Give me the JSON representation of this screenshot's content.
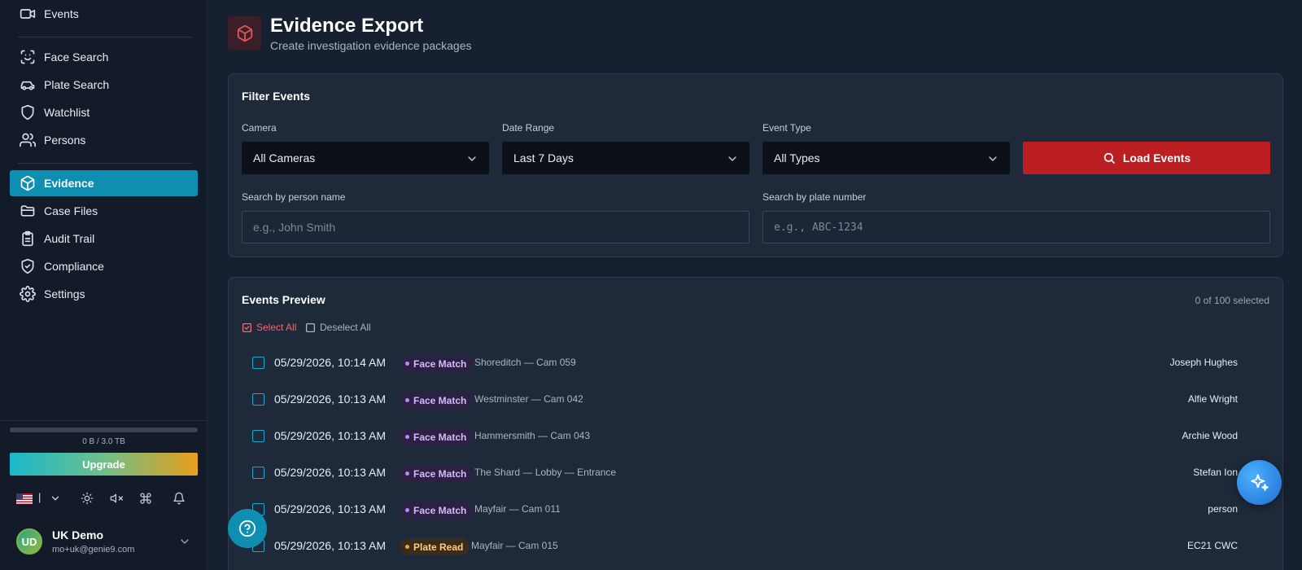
{
  "sidebar": {
    "nav_items": [
      {
        "id": "events",
        "label": "Events",
        "icon": "video-icon"
      },
      {
        "id": "face-search",
        "label": "Face Search",
        "icon": "face-scan-icon"
      },
      {
        "id": "plate-search",
        "label": "Plate Search",
        "icon": "car-icon"
      },
      {
        "id": "watchlist",
        "label": "Watchlist",
        "icon": "shield-icon"
      },
      {
        "id": "persons",
        "label": "Persons",
        "icon": "users-icon"
      },
      {
        "id": "evidence",
        "label": "Evidence",
        "icon": "package-icon",
        "active": true
      },
      {
        "id": "case-files",
        "label": "Case Files",
        "icon": "folder-icon"
      },
      {
        "id": "audit-trail",
        "label": "Audit Trail",
        "icon": "clipboard-icon"
      },
      {
        "id": "compliance",
        "label": "Compliance",
        "icon": "shield-check-icon"
      },
      {
        "id": "settings",
        "label": "Settings",
        "icon": "gear-icon"
      }
    ],
    "storage": {
      "text": "0 B / 3.0 TB",
      "used_fraction": 0.0
    },
    "upgrade_label": "Upgrade",
    "language_separator": "|",
    "user": {
      "initials": "UD",
      "name": "UK Demo",
      "email": "mo+uk@genie9.com"
    }
  },
  "header": {
    "title": "Evidence Export",
    "subtitle": "Create investigation evidence packages"
  },
  "filter": {
    "title": "Filter Events",
    "camera_label": "Camera",
    "camera_value": "All Cameras",
    "date_label": "Date Range",
    "date_value": "Last 7 Days",
    "type_label": "Event Type",
    "type_value": "All Types",
    "load_label": "Load Events",
    "person_label": "Search by person name",
    "person_placeholder": "e.g., John Smith",
    "plate_label": "Search by plate number",
    "plate_placeholder": "e.g., ABC-1234"
  },
  "preview": {
    "title": "Events Preview",
    "selected_count": "0 of 100 selected",
    "select_all": "Select All",
    "deselect_all": "Deselect All",
    "events": [
      {
        "time": "05/29/2026, 10:14 AM",
        "type": "Face Match",
        "kind": "face",
        "location": "Shoreditch — Cam 059",
        "subject": "Joseph Hughes"
      },
      {
        "time": "05/29/2026, 10:13 AM",
        "type": "Face Match",
        "kind": "face",
        "location": "Westminster — Cam 042",
        "subject": "Alfie Wright"
      },
      {
        "time": "05/29/2026, 10:13 AM",
        "type": "Face Match",
        "kind": "face",
        "location": "Hammersmith — Cam 043",
        "subject": "Archie Wood"
      },
      {
        "time": "05/29/2026, 10:13 AM",
        "type": "Face Match",
        "kind": "face",
        "location": "The Shard — Lobby — Entrance",
        "subject": "Stefan Ion"
      },
      {
        "time": "05/29/2026, 10:13 AM",
        "type": "Face Match",
        "kind": "face",
        "location": "Mayfair — Cam 011",
        "subject": "person"
      },
      {
        "time": "05/29/2026, 10:13 AM",
        "type": "Plate Read",
        "kind": "plate",
        "location": "Mayfair — Cam 015",
        "subject": "EC21 CWC"
      }
    ]
  },
  "colors": {
    "accent": "#0e8fb1",
    "danger": "#bb1f22",
    "face_badge": "#b987ff",
    "plate_badge": "#f5a623"
  }
}
